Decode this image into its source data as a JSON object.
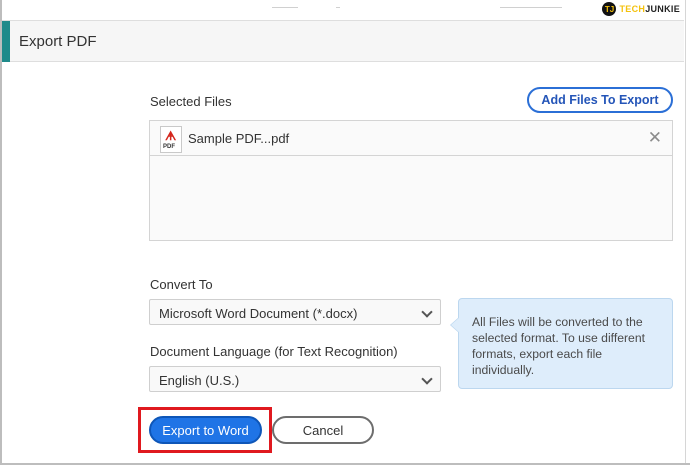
{
  "watermark": {
    "logo": "TJ",
    "text_a": "TECH",
    "text_b": "JUNKIE"
  },
  "dialog": {
    "title": "Export PDF"
  },
  "selected_files": {
    "label": "Selected Files",
    "add_button": "Add Files To Export",
    "files": [
      {
        "name": "Sample PDF...pdf",
        "icon": "pdf-file-icon",
        "icon_tag": "PDF"
      }
    ],
    "remove_glyph": "✕"
  },
  "convert_to": {
    "label": "Convert To",
    "selected": "Microsoft Word Document (*.docx)"
  },
  "language": {
    "label": "Document Language (for Text Recognition)",
    "selected": "English (U.S.)"
  },
  "info_text": "All Files will be converted to the selected format. To use different formats, export each file individually.",
  "actions": {
    "export_label": "Export to Word",
    "cancel_label": "Cancel"
  },
  "colors": {
    "accent": "#1f8a8a",
    "primary": "#1f74e6",
    "highlight": "#e0191f",
    "info_bg": "#deedfb"
  }
}
